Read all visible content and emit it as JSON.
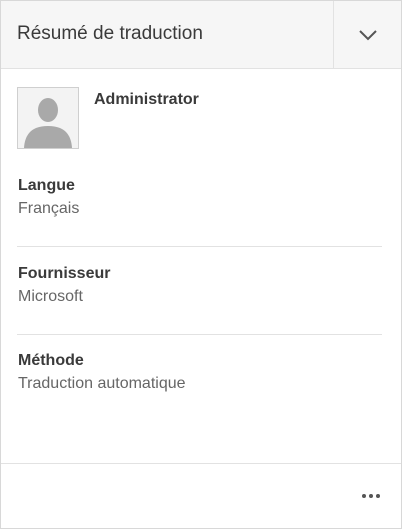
{
  "panel": {
    "title": "Résumé de traduction",
    "toggle_icon": "chevron-down-icon"
  },
  "user": {
    "name": "Administrator",
    "avatar_icon": "user-silhouette-icon"
  },
  "fields": [
    {
      "label": "Langue",
      "value": "Français"
    },
    {
      "label": "Fournisseur",
      "value": "Microsoft"
    },
    {
      "label": "Méthode",
      "value": "Traduction automatique"
    }
  ],
  "footer": {
    "more_icon": "more-horizontal-icon"
  }
}
